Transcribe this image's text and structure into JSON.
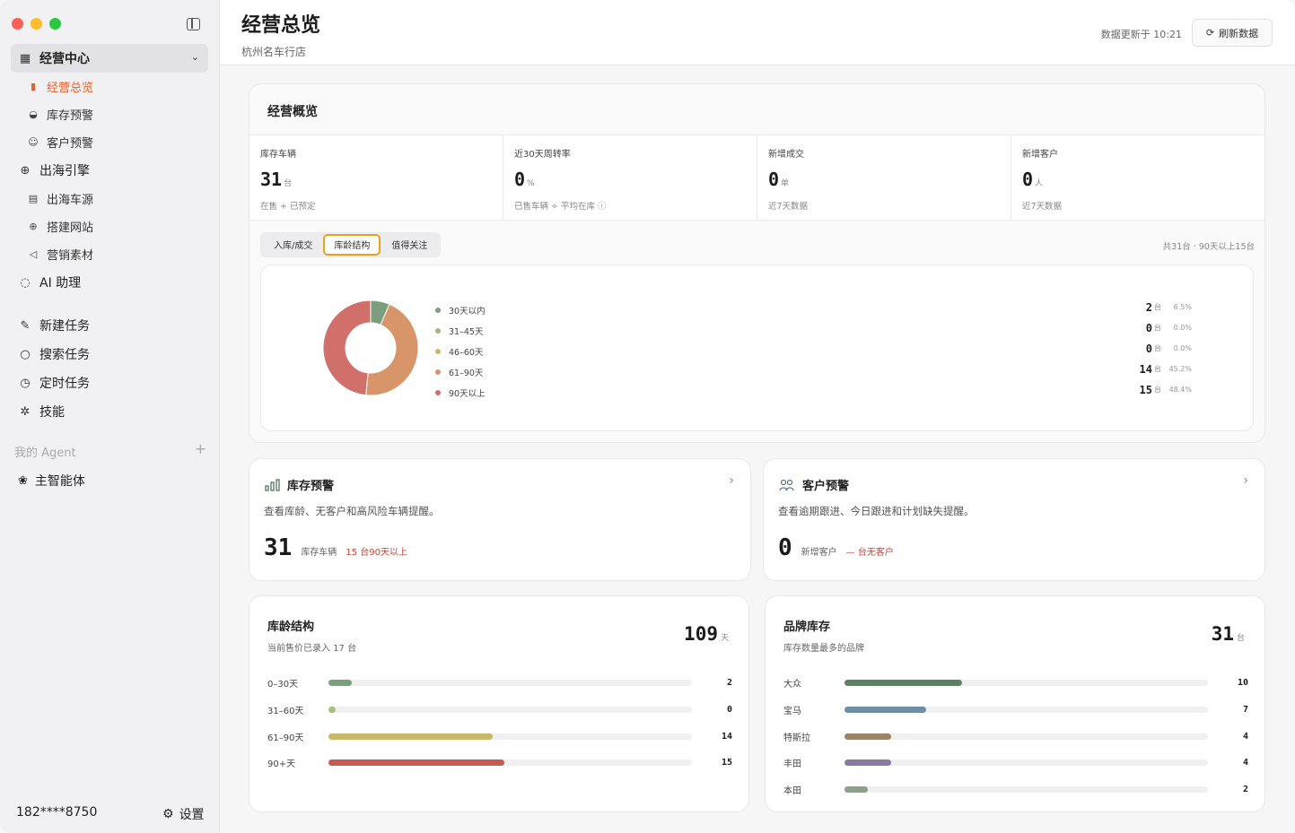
{
  "sidebar": {
    "groups": [
      {
        "label": "经营中心",
        "icon": "building-icon"
      },
      {
        "label": "出海引擎",
        "icon": "globe-icon"
      }
    ],
    "sub_business": [
      {
        "label": "经营总览",
        "icon": "bar-chart-icon"
      },
      {
        "label": "库存预警",
        "icon": "car-icon"
      },
      {
        "label": "客户预警",
        "icon": "users-icon"
      }
    ],
    "sub_overseas": [
      {
        "label": "出海车源",
        "icon": "store-icon"
      },
      {
        "label": "搭建网站",
        "icon": "globe-icon"
      },
      {
        "label": "营销素材",
        "icon": "megaphone-icon"
      }
    ],
    "ai_assistant": "AI 助理",
    "tasks": [
      {
        "label": "新建任务",
        "icon": "edit-icon"
      },
      {
        "label": "搜索任务",
        "icon": "search-icon"
      },
      {
        "label": "定时任务",
        "icon": "clock-icon"
      },
      {
        "label": "技能",
        "icon": "puzzle-icon"
      }
    ],
    "agent_header": "我的 Agent",
    "agent_add": "+",
    "agent_item": "主智能体",
    "user_phone": "182****8750",
    "settings_label": "设置"
  },
  "header": {
    "title": "经营总览",
    "subtitle": "杭州名车行店",
    "update_time": "数据更新于 10:21",
    "refresh_label": "刷新数据"
  },
  "overview": {
    "title": "经营概览",
    "kpis": [
      {
        "label": "库存车辆",
        "value": "31",
        "unit": "台",
        "note": "在售 + 已预定"
      },
      {
        "label": "近30天周转率",
        "value": "0",
        "unit": "%",
        "note": "已售车辆 ÷ 平均在库 ⓘ"
      },
      {
        "label": "新增成交",
        "value": "0",
        "unit": "单",
        "note": "近7天数据"
      },
      {
        "label": "新增客户",
        "value": "0",
        "unit": "人",
        "note": "近7天数据"
      }
    ],
    "tabs": [
      "入库/成交",
      "库龄结构",
      "值得关注"
    ],
    "active_tab": 1,
    "summary": "共31台 · 90天以上15台"
  },
  "chart_data": [
    {
      "type": "pie",
      "categories": [
        "30天以内",
        "31–45天",
        "46–60天",
        "61–90天",
        "90天以上"
      ],
      "values": [
        2,
        0,
        0,
        14,
        15
      ],
      "unit": "台",
      "percents": [
        "6.5%",
        "0.0%",
        "0.0%",
        "45.2%",
        "48.4%"
      ],
      "colors": [
        "#7a9e7e",
        "#a3b27a",
        "#c8b86a",
        "#d9956a",
        "#d1706a"
      ]
    },
    {
      "type": "bar",
      "title": "库龄结构",
      "subtitle": "当前售价已录入 17 台",
      "total": "109",
      "total_unit": "天",
      "categories": [
        "0–30天",
        "31–60天",
        "61–90天",
        "90+天"
      ],
      "values": [
        2,
        0,
        14,
        15
      ],
      "max": 31,
      "colors": [
        "#7d9f80",
        "#a7bf7c",
        "#c8b86a",
        "#c65a54"
      ]
    },
    {
      "type": "bar",
      "title": "品牌库存",
      "subtitle": "库存数量最多的品牌",
      "total": "31",
      "total_unit": "台",
      "categories": [
        "大众",
        "宝马",
        "特斯拉",
        "丰田",
        "本田"
      ],
      "values": [
        10,
        7,
        4,
        4,
        2
      ],
      "max": 31,
      "colors": [
        "#5f7e66",
        "#6f8fa8",
        "#9b8466",
        "#8b7aa0",
        "#8ea08a"
      ]
    }
  ],
  "warnings": [
    {
      "title": "库存预警",
      "icon": "bar-chart-icon",
      "desc": "查看库龄、无客户和高风险车辆提醒。",
      "value": "31",
      "label": "库存车辆",
      "alert": "15 台90天以上"
    },
    {
      "title": "客户预警",
      "icon": "users-icon",
      "desc": "查看逾期跟进、今日跟进和计划缺失提醒。",
      "value": "0",
      "label": "新增客户",
      "alert": "— 台无客户"
    }
  ]
}
